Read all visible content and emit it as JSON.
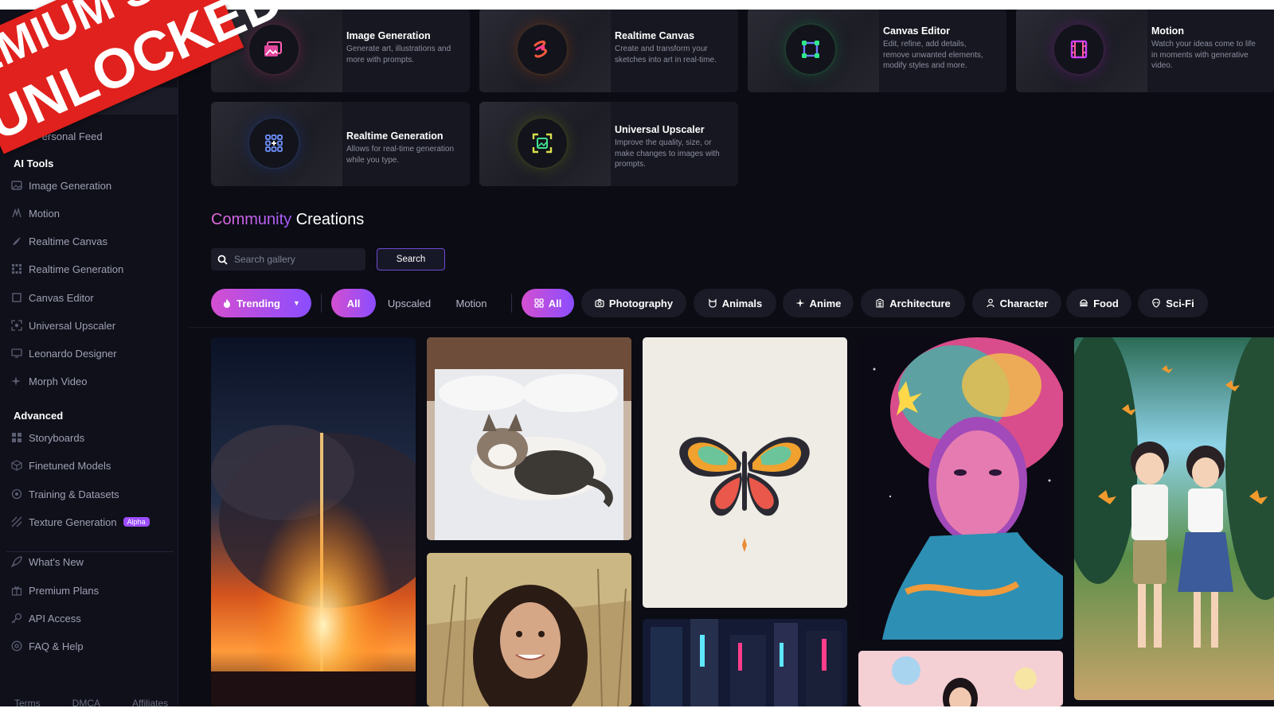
{
  "overlay": {
    "line1": "EMIUM SA",
    "line2": "UNLOCKED"
  },
  "sidebar": {
    "personal_feed": "Personal Feed",
    "ai_tools_heading": "AI Tools",
    "ai_tools": [
      {
        "label": "Image Generation",
        "icon": "image-icon"
      },
      {
        "label": "Motion",
        "icon": "motion-icon"
      },
      {
        "label": "Realtime Canvas",
        "icon": "brush-icon"
      },
      {
        "label": "Realtime Generation",
        "icon": "grid-icon"
      },
      {
        "label": "Canvas Editor",
        "icon": "canvas-icon"
      },
      {
        "label": "Universal Upscaler",
        "icon": "upscale-icon"
      },
      {
        "label": "Leonardo Designer",
        "icon": "designer-icon"
      },
      {
        "label": "Morph Video",
        "icon": "sparkle-icon"
      }
    ],
    "advanced_heading": "Advanced",
    "advanced": [
      {
        "label": "Storyboards",
        "icon": "storyboard-icon"
      },
      {
        "label": "Finetuned Models",
        "icon": "cube-icon"
      },
      {
        "label": "Training & Datasets",
        "icon": "dataset-icon"
      },
      {
        "label": "Texture Generation",
        "icon": "texture-icon",
        "badge": "Alpha"
      }
    ],
    "bottom": [
      {
        "label": "What's New",
        "icon": "rocket-icon"
      },
      {
        "label": "Premium Plans",
        "icon": "gift-icon"
      },
      {
        "label": "API Access",
        "icon": "key-icon"
      },
      {
        "label": "FAQ & Help",
        "icon": "help-icon"
      }
    ],
    "footer": [
      "Terms",
      "DMCA",
      "Affiliates"
    ]
  },
  "tools": [
    {
      "title": "Image Generation",
      "desc": "Generate art, illustrations and more with prompts.",
      "icon": "image-icon",
      "accent": "#e2479e"
    },
    {
      "title": "Realtime Canvas",
      "desc": "Create and transform your sketches into art in real-time.",
      "icon": "brush-icon",
      "accent": "#ff5a3c"
    },
    {
      "title": "Canvas Editor",
      "desc": "Edit, refine, add details, remove unwanted elements, modify styles and more.",
      "icon": "canvas-icon",
      "accent": "#2ee88a"
    },
    {
      "title": "Motion",
      "desc": "Watch your ideas come to life in moments with generative video.",
      "icon": "film-icon",
      "accent": "#c93dff"
    },
    {
      "title": "Realtime Generation",
      "desc": "Allows for real-time generation while you type.",
      "icon": "grid-icon",
      "accent": "#5b8cff"
    },
    {
      "title": "Universal Upscaler",
      "desc": "Improve the quality, size, or make changes to images with prompts.",
      "icon": "upscale-icon",
      "accent": "#d8e04a"
    }
  ],
  "community": {
    "title_part1": "Community",
    "title_part2": "Creations",
    "search_placeholder": "Search gallery",
    "search_button": "Search",
    "sort_chip": "Trending",
    "type_filters": [
      "All",
      "Upscaled",
      "Motion"
    ],
    "categories": [
      {
        "label": "All",
        "icon": "grid-icon"
      },
      {
        "label": "Photography",
        "icon": "camera-icon"
      },
      {
        "label": "Animals",
        "icon": "animal-icon"
      },
      {
        "label": "Anime",
        "icon": "sparkle-icon"
      },
      {
        "label": "Architecture",
        "icon": "building-icon"
      },
      {
        "label": "Character",
        "icon": "person-icon"
      },
      {
        "label": "Food",
        "icon": "food-icon"
      },
      {
        "label": "Sci-Fi",
        "icon": "alien-icon"
      }
    ]
  },
  "colors": {
    "accent_pink": "#e36bd8",
    "accent_purple": "#8a4dff",
    "background": "#0b0c14",
    "overlay_red": "#e0211d"
  }
}
